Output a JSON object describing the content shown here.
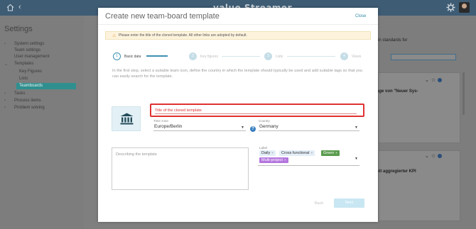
{
  "topbar": {
    "logo": "value Streamer",
    "icons": [
      "home-icon",
      "chevron-left-icon",
      "gear-icon",
      "avatar"
    ]
  },
  "sidebar": {
    "title": "Settings",
    "items": [
      {
        "label": "System settings",
        "expandable": true
      },
      {
        "label": "Team settings"
      },
      {
        "label": "User management"
      },
      {
        "label": "Templates",
        "expanded": true
      },
      {
        "label": "Key Figures"
      },
      {
        "label": "Lists"
      },
      {
        "label": "Teamboards",
        "active": true
      },
      {
        "label": "Tasks",
        "expandable": true
      },
      {
        "label": "Process items",
        "expandable": true
      },
      {
        "label": "Problem solving",
        "expandable": true
      }
    ]
  },
  "right_panel": {
    "text1": "in standards for",
    "text2": "age von \"Neuer Sys-",
    "text3": "nit aggregierter KPI"
  },
  "modal": {
    "title": "Create new team-board template",
    "close_label": "Close",
    "warning": "Please enter the title of the cloned template. All other links are adopted by default.",
    "steps": [
      {
        "number": "1",
        "label": "Basic data",
        "active": true
      },
      {
        "number": "2",
        "label": "Key figures"
      },
      {
        "number": "3",
        "label": "Lists"
      },
      {
        "number": "4",
        "label": "Views"
      }
    ],
    "intro": "In the first step, select a suitable team icon, define the country in which the template should typically be used and add suitable tags so that you can easily search for the template.",
    "title_field": {
      "placeholder": "Title of the cloned template"
    },
    "time_zone": {
      "label": "Time zone",
      "value": "Europe/Berlin"
    },
    "country": {
      "label": "Country",
      "value": "Germany"
    },
    "description": {
      "placeholder": "Describing the template"
    },
    "labels": {
      "label": "Label",
      "tags": [
        {
          "text": "Daily",
          "style": "light"
        },
        {
          "text": "Cross functional",
          "style": "light"
        },
        {
          "text": "Green",
          "style": "green"
        },
        {
          "text": "Multi-project",
          "style": "purple"
        }
      ]
    },
    "back_label": "Back",
    "next_label": "Next"
  },
  "colors": {
    "topbar": "#3e5c74",
    "accent": "#2f8f8f",
    "error": "#e03131",
    "step_active": "#3d90b0"
  }
}
